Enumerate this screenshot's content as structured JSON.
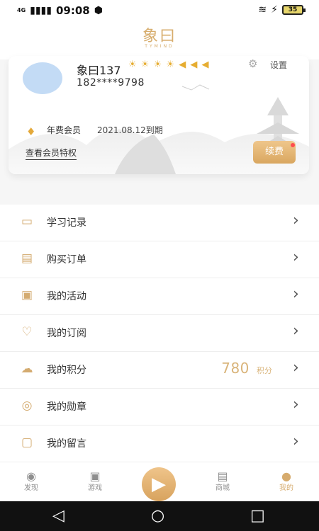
{
  "status_bar": {
    "network": "4G",
    "time": "09:08",
    "battery": "35"
  },
  "app": {
    "logo_cn": "象曰",
    "logo_en": "TYMIND"
  },
  "profile": {
    "name": "象曰137",
    "phone": "182****9798",
    "settings_label": "设置",
    "badge_icons": [
      "sun-icon",
      "sun-icon",
      "sun-icon",
      "sun-icon",
      "megaphone-icon",
      "megaphone-icon",
      "megaphone-icon"
    ],
    "membership_label": "年费会员",
    "expire_text": "2021.08.12到期",
    "benefits_label": "查看会员特权",
    "renew_label": "续费"
  },
  "menu": [
    {
      "label": "学习记录",
      "icon": "book-icon"
    },
    {
      "label": "购买订单",
      "icon": "clipboard-icon"
    },
    {
      "label": "我的活动",
      "icon": "gift-icon"
    },
    {
      "label": "我的订阅",
      "icon": "heart-icon"
    },
    {
      "label": "我的积分",
      "icon": "cloud-sun-icon",
      "value": "780",
      "unit": "积分"
    },
    {
      "label": "我的勋章",
      "icon": "medal-icon"
    },
    {
      "label": "我的留言",
      "icon": "message-icon"
    }
  ],
  "bottom_nav": [
    {
      "label": "发现",
      "icon": "compass-icon"
    },
    {
      "label": "游戏",
      "icon": "gamepad-icon"
    },
    {
      "label": "",
      "icon": "play-icon"
    },
    {
      "label": "商城",
      "icon": "bag-icon"
    },
    {
      "label": "我的",
      "icon": "user-icon"
    }
  ],
  "colors": {
    "accent": "#d6ab6d",
    "avatar": "#c3dbf5",
    "text": "#333333",
    "background": "#f6f6f6"
  }
}
